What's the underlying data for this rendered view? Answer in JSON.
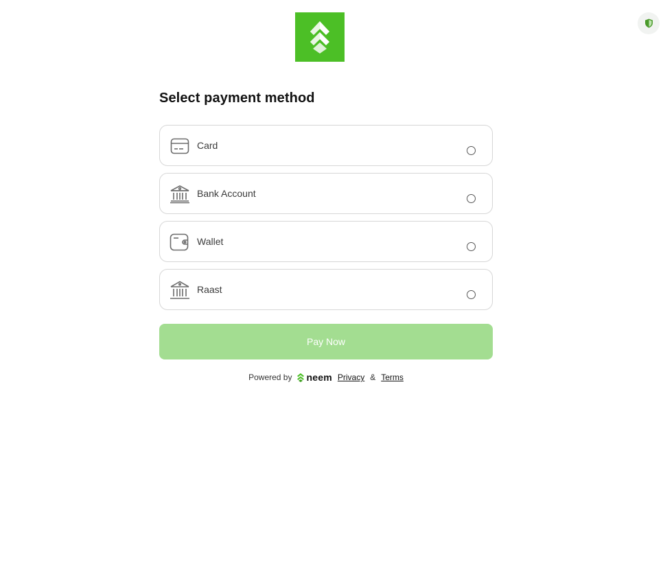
{
  "header": {
    "logo_icon": "leaf-chevron-logo",
    "shield_icon": "shield-icon",
    "brand_color": "#4cbf26"
  },
  "title": "Select payment method",
  "methods": [
    {
      "label": "Card",
      "icon": "card-icon",
      "selected": false
    },
    {
      "label": "Bank Account",
      "icon": "bank-icon",
      "selected": false
    },
    {
      "label": "Wallet",
      "icon": "wallet-icon",
      "selected": false
    },
    {
      "label": "Raast",
      "icon": "raast-icon",
      "selected": false
    }
  ],
  "pay_button": {
    "label": "Pay Now",
    "color": "#a3dd91",
    "enabled": false
  },
  "footer": {
    "powered_by": "Powered by",
    "brand_word": "neem",
    "privacy_label": "Privacy",
    "amp": "&",
    "terms_label": "Terms"
  }
}
